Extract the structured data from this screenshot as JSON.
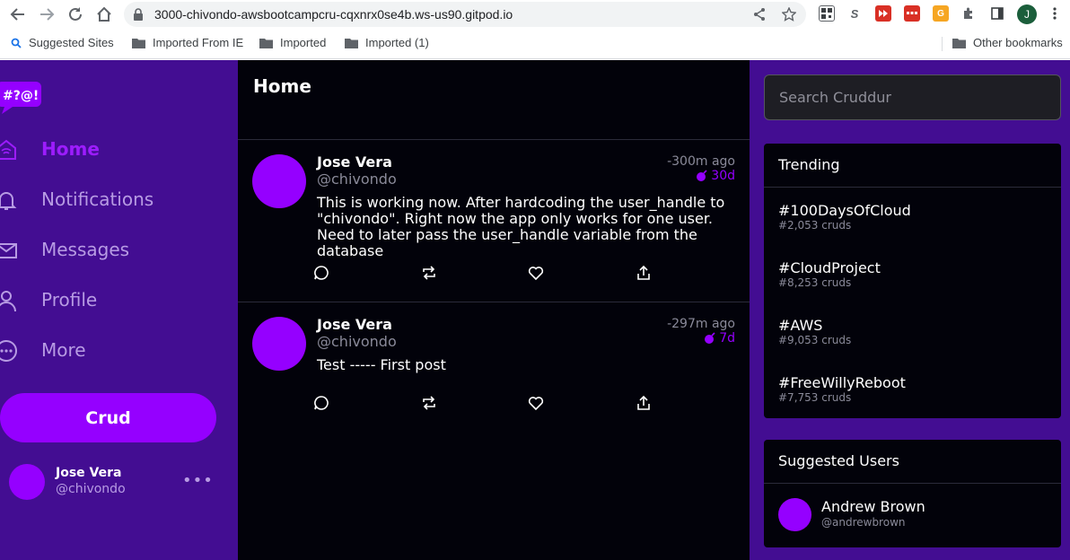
{
  "browser": {
    "url": "3000-chivondo-awsbootcampcru-cqxnrx0se4b.ws-us90.gitpod.io",
    "profile_initial": "J",
    "bookmarks": [
      "Suggested Sites",
      "Imported From IE",
      "Imported",
      "Imported (1)"
    ],
    "other_bookmarks": "Other bookmarks"
  },
  "sidebar": {
    "logo_text": "#?@!",
    "items": [
      {
        "label": "Home",
        "icon": "home-icon",
        "active": true
      },
      {
        "label": "Notifications",
        "icon": "bell-icon",
        "active": false
      },
      {
        "label": "Messages",
        "icon": "mail-icon",
        "active": false
      },
      {
        "label": "Profile",
        "icon": "user-icon",
        "active": false
      },
      {
        "label": "More",
        "icon": "more-icon",
        "active": false
      }
    ],
    "crud_label": "Crud",
    "profile": {
      "name": "Jose Vera",
      "handle": "@chivondo",
      "more": "•••"
    }
  },
  "main": {
    "title": "Home",
    "activities": [
      {
        "name": "Jose Vera",
        "handle": "@chivondo",
        "message": "This is working now. After hardcoding the user_handle to \"chivondo\". Right now the app only works for one user. Need to later pass the user_handle variable from the database",
        "created": "-300m ago",
        "expires": "30d"
      },
      {
        "name": "Jose Vera",
        "handle": "@chivondo",
        "message": "Test ----- First post",
        "created": "-297m ago",
        "expires": "7d"
      }
    ]
  },
  "right": {
    "search_placeholder": "Search Cruddur",
    "trending_title": "Trending",
    "trending": [
      {
        "title": "#100DaysOfCloud",
        "count": "#2,053 cruds"
      },
      {
        "title": "#CloudProject",
        "count": "#8,253 cruds"
      },
      {
        "title": "#AWS",
        "count": "#9,053 cruds"
      },
      {
        "title": "#FreeWillyReboot",
        "count": "#7,753 cruds"
      }
    ],
    "suggested_title": "Suggested Users",
    "suggested": [
      {
        "name": "Andrew Brown",
        "handle": "@andrewbrown"
      }
    ]
  },
  "colors": {
    "accent": "#9500ff",
    "sidebar_bg": "#430d92",
    "main_bg": "#02020a",
    "muted": "#8a8a99"
  }
}
